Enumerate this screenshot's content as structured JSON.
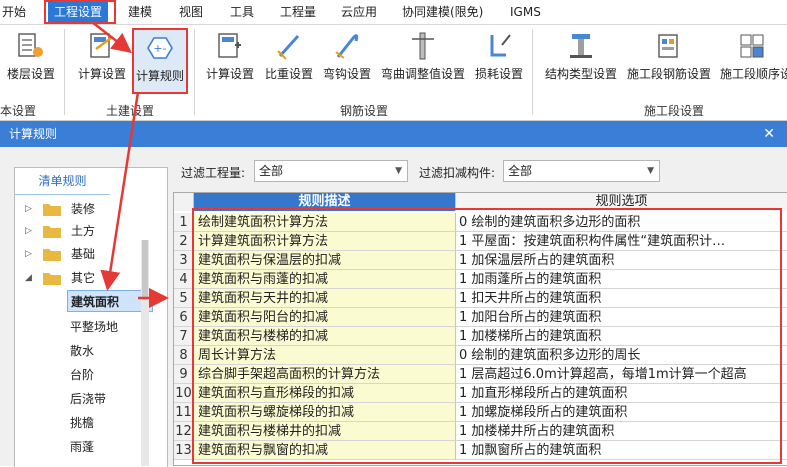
{
  "menu": {
    "items": [
      {
        "id": "start",
        "label": "开始"
      },
      {
        "id": "project",
        "label": "工程设置",
        "active": true
      },
      {
        "id": "model",
        "label": "建模"
      },
      {
        "id": "view",
        "label": "视图"
      },
      {
        "id": "tools",
        "label": "工具"
      },
      {
        "id": "quantity",
        "label": "工程量"
      },
      {
        "id": "cloud",
        "label": "云应用"
      },
      {
        "id": "collab",
        "label": "协同建模(限免)"
      },
      {
        "id": "igms",
        "label": "IGMS"
      }
    ]
  },
  "ribbon": {
    "buttons": [
      {
        "id": "floor",
        "label": "楼层设置",
        "icon": "floor-settings-icon"
      },
      {
        "id": "calc",
        "label": "计算设置",
        "icon": "calc-settings-icon"
      },
      {
        "id": "rules",
        "label": "计算规则",
        "icon": "calc-rules-icon",
        "highlight": true
      },
      {
        "id": "rebar-calc",
        "label": "计算设置",
        "icon": "rebar-calc-icon"
      },
      {
        "id": "ratio",
        "label": "比重设置",
        "icon": "weight-ratio-icon"
      },
      {
        "id": "hook",
        "label": "弯钩设置",
        "icon": "hook-settings-icon"
      },
      {
        "id": "bend",
        "label": "弯曲调整值设置",
        "icon": "bend-adjust-icon"
      },
      {
        "id": "loss",
        "label": "损耗设置",
        "icon": "loss-settings-icon"
      },
      {
        "id": "struct",
        "label": "结构类型设置",
        "icon": "structure-type-icon"
      },
      {
        "id": "segrebar",
        "label": "施工段钢筋设置",
        "icon": "segment-rebar-icon"
      },
      {
        "id": "segorder",
        "label": "施工段顺序设",
        "icon": "segment-order-icon"
      }
    ],
    "groups": [
      {
        "id": "g1",
        "label": "本设置"
      },
      {
        "id": "g2",
        "label": "土建设置"
      },
      {
        "id": "g3",
        "label": "钢筋设置"
      },
      {
        "id": "g4",
        "label": "施工段设置"
      }
    ]
  },
  "dialog": {
    "title": "计算规则",
    "close": "✕",
    "tree_tab": "清单规则",
    "tree": [
      {
        "label": "装修",
        "expanded": false
      },
      {
        "label": "土方",
        "expanded": false
      },
      {
        "label": "基础",
        "expanded": false
      },
      {
        "label": "其它",
        "expanded": true
      }
    ],
    "leaves": [
      "建筑面积",
      "平整场地",
      "散水",
      "台阶",
      "后浇带",
      "挑檐",
      "雨蓬"
    ],
    "selected_leaf": "建筑面积",
    "filter1_label": "过滤工程量:",
    "filter1_value": "全部",
    "filter2_label": "过滤扣减构件:",
    "filter2_value": "全部",
    "columns": {
      "desc": "规则描述",
      "options": "规则选项"
    },
    "rows": [
      {
        "n": "1",
        "desc": "绘制建筑面积计算方法",
        "opt": "0 绘制的建筑面积多边形的面积"
      },
      {
        "n": "2",
        "desc": "计算建筑面积计算方法",
        "opt": "1 平屋面：按建筑面积构件属性“建筑面积计…"
      },
      {
        "n": "3",
        "desc": "建筑面积与保温层的扣减",
        "opt": "1 加保温层所占的建筑面积"
      },
      {
        "n": "4",
        "desc": "建筑面积与雨蓬的扣减",
        "opt": "1 加雨蓬所占的建筑面积"
      },
      {
        "n": "5",
        "desc": "建筑面积与天井的扣减",
        "opt": "1 扣天井所占的建筑面积"
      },
      {
        "n": "6",
        "desc": "建筑面积与阳台的扣减",
        "opt": "1 加阳台所占的建筑面积"
      },
      {
        "n": "7",
        "desc": "建筑面积与楼梯的扣减",
        "opt": "1 加楼梯所占的建筑面积"
      },
      {
        "n": "8",
        "desc": "周长计算方法",
        "opt": "0 绘制的建筑面积多边形的周长"
      },
      {
        "n": "9",
        "desc": "综合脚手架超高面积的计算方法",
        "opt": "1 层高超过6.0m计算超高，每增1m计算一个超高"
      },
      {
        "n": "10",
        "desc": "建筑面积与直形梯段的扣减",
        "opt": "1 加直形梯段所占的建筑面积"
      },
      {
        "n": "11",
        "desc": "建筑面积与螺旋梯段的扣减",
        "opt": "1 加螺旋梯段所占的建筑面积"
      },
      {
        "n": "12",
        "desc": "建筑面积与楼梯井的扣减",
        "opt": "1 加楼梯井所占的建筑面积"
      },
      {
        "n": "13",
        "desc": "建筑面积与飘窗的扣减",
        "opt": "1 加飘窗所占的建筑面积"
      }
    ]
  },
  "colors": {
    "accent": "#3a7fd5",
    "annotation": "#e53935",
    "desc_cell": "#fbfbd1"
  }
}
